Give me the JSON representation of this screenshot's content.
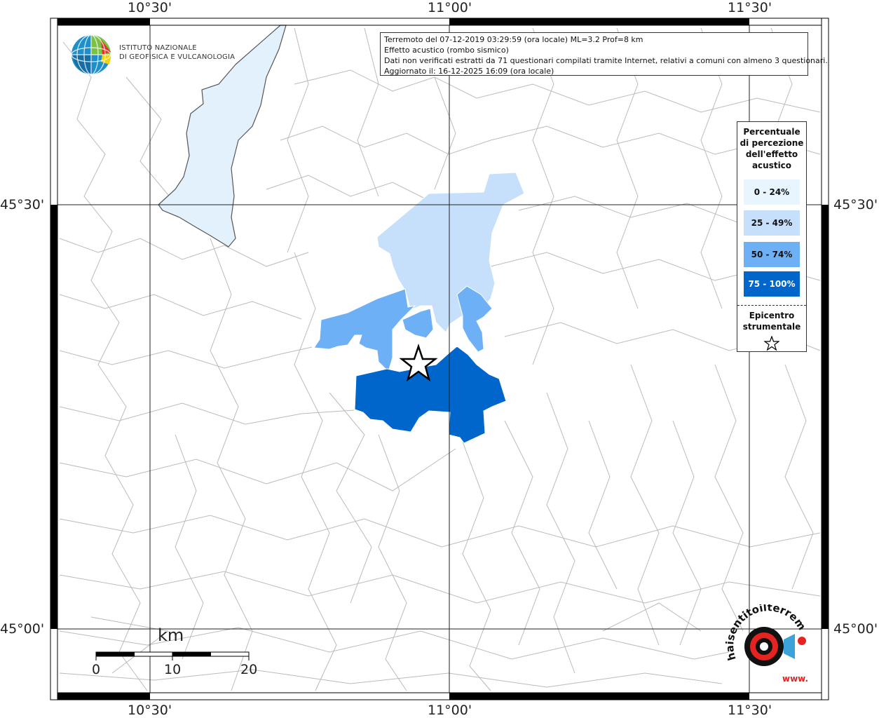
{
  "map": {
    "coordinate_labels": {
      "lon": [
        "10°30'",
        "11°00'",
        "11°30'"
      ],
      "lat": [
        "45°30'",
        "45°00'"
      ]
    },
    "colors": {
      "class_0_24": "#e8f4fe",
      "class_25_49": "#c6e0fb",
      "class_50_74": "#6eb0f6",
      "class_75_100": "#0066cc",
      "lake": "#e3f1fc",
      "municipality_border": "#b8b8b8"
    }
  },
  "info_box": {
    "line1": "Terremoto del 07-12-2019 03:29:59 (ora locale) ML=3.2 Prof=8 km",
    "line2": "Effetto acustico (rombo sismico)",
    "line3": "Dati non verificati estratti da 71 questionari compilati tramite Internet, relativi a comuni con almeno 3 questionari.",
    "line4": "Aggiornato il: 16-12-2025 16:09 (ora locale)"
  },
  "legend": {
    "title_lines": [
      "Percentuale",
      "di percezione",
      "dell'effetto",
      "acustico"
    ],
    "items": [
      {
        "label": "0 - 24%",
        "color": "#e8f4fe",
        "text_color": "#111111"
      },
      {
        "label": "25 - 49%",
        "color": "#c6e0fb",
        "text_color": "#111111"
      },
      {
        "label": "50 - 74%",
        "color": "#6eb0f6",
        "text_color": "#111111"
      },
      {
        "label": "75 - 100%",
        "color": "#0066cc",
        "text_color": "#ffffff"
      }
    ],
    "epicenter_lines": [
      "Epicentro",
      "strumentale"
    ],
    "epicenter_icon": "star-outline-icon"
  },
  "logo_ingv": {
    "line1": "ISTITUTO NAZIONALE",
    "line2": "DI GEOFISICA E VULCANOLOGIA"
  },
  "logo_haisentito": {
    "text": "haisentitoilterremoto.it",
    "prefix": "www."
  },
  "scale_bar": {
    "unit": "km",
    "labels": [
      "0",
      "10",
      "20"
    ]
  }
}
